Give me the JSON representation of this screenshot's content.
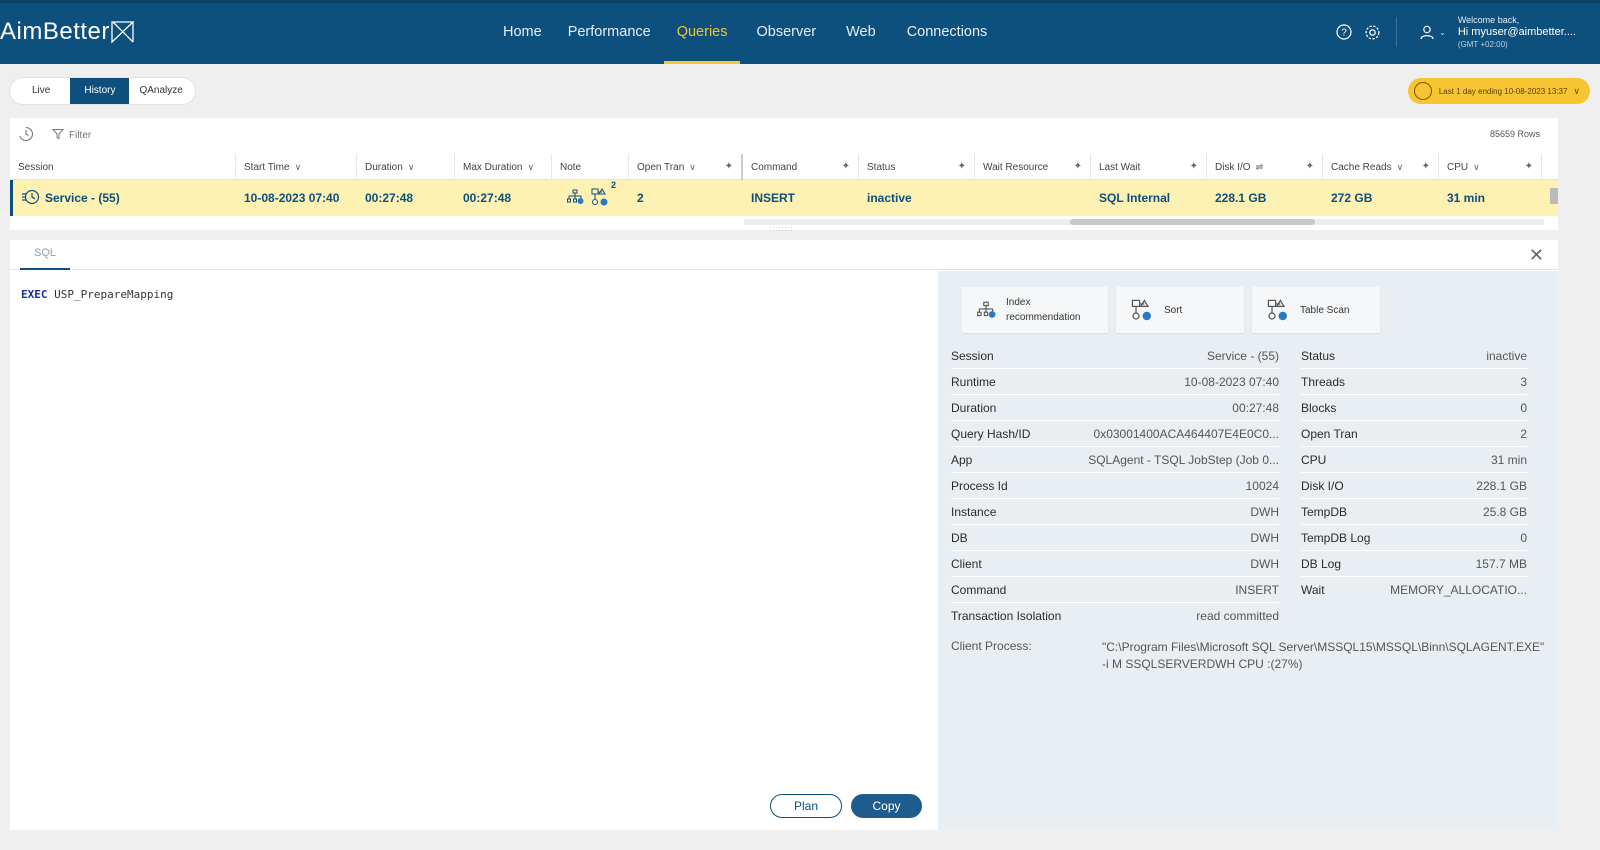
{
  "header": {
    "logo_text": "AimBetter",
    "nav": [
      {
        "label": "Home",
        "active": false
      },
      {
        "label": "Performance",
        "active": false
      },
      {
        "label": "Queries",
        "active": true
      },
      {
        "label": "Observer",
        "active": false
      },
      {
        "label": "Web",
        "active": false
      },
      {
        "label": "Connections",
        "active": false
      }
    ],
    "welcome": "Welcome back,",
    "user": "Hi myuser@aimbetter....",
    "timezone": "(GMT +02:00)",
    "icons": [
      "help-icon",
      "settings-icon",
      "user-icon"
    ]
  },
  "mode_tabs": [
    {
      "label": "Live",
      "active": false
    },
    {
      "label": "History",
      "active": true
    },
    {
      "label": "QAnalyze",
      "active": false
    }
  ],
  "time_range": "Last 1 day ending 10-08-2023 13:37",
  "toolbar": {
    "filter_label": "Filter",
    "row_count": "85659 Rows"
  },
  "table": {
    "columns": [
      "Session",
      "Start Time",
      "Duration",
      "Max Duration",
      "Note",
      "Open Tran",
      "Command",
      "Status",
      "Wait Resource",
      "Last Wait",
      "Disk I/O",
      "Cache Reads",
      "CPU"
    ],
    "row": {
      "session": "Service - (55)",
      "start_time": "10-08-2023 07:40",
      "duration": "00:27:48",
      "max_duration": "00:27:48",
      "note_badge": "2",
      "open_tran": "2",
      "command": "INSERT",
      "status": "inactive",
      "wait_resource": "",
      "last_wait": "SQL Internal",
      "disk_io": "228.1 GB",
      "cache_reads": "272 GB",
      "cpu": "31 min"
    }
  },
  "detail": {
    "tab": "SQL",
    "sql_keyword": "EXEC",
    "sql_body": " USP_PrepareMapping",
    "plan_label": "Plan",
    "copy_label": "Copy",
    "actions": {
      "index": "Index recommendation",
      "sort": "Sort",
      "scan": "Table Scan"
    },
    "left_kv": [
      {
        "k": "Session",
        "v": "Service - (55)"
      },
      {
        "k": "Runtime",
        "v": "10-08-2023 07:40"
      },
      {
        "k": "Duration",
        "v": "00:27:48"
      },
      {
        "k": "Query Hash/ID",
        "v": "0x03001400ACA464407E4E0C0..."
      },
      {
        "k": "App",
        "v": "SQLAgent - TSQL JobStep (Job 0..."
      },
      {
        "k": "Process Id",
        "v": "10024"
      },
      {
        "k": "Instance",
        "v": "DWH"
      },
      {
        "k": "DB",
        "v": "DWH"
      },
      {
        "k": "Client",
        "v": "DWH"
      },
      {
        "k": "Command",
        "v": "INSERT"
      },
      {
        "k": "Transaction Isolation",
        "v": "read committed"
      }
    ],
    "right_kv": [
      {
        "k": "Status",
        "v": "inactive"
      },
      {
        "k": "Threads",
        "v": "3"
      },
      {
        "k": "Blocks",
        "v": "0"
      },
      {
        "k": "Open Tran",
        "v": "2"
      },
      {
        "k": "CPU",
        "v": "31 min"
      },
      {
        "k": "Disk I/O",
        "v": "228.1 GB"
      },
      {
        "k": "TempDB",
        "v": "25.8 GB"
      },
      {
        "k": "TempDB Log",
        "v": "0"
      },
      {
        "k": "DB Log",
        "v": "157.7 MB"
      },
      {
        "k": "Wait",
        "v": "MEMORY_ALLOCATIO..."
      }
    ],
    "client_process_label": "Client Process:",
    "client_process_value": "\"C:\\Program Files\\Microsoft SQL Server\\MSSQL15\\MSSQL\\Binn\\SQLAGENT.EXE\" -i M SSQLSERVERDWH CPU :(27%)"
  },
  "colors": {
    "brand": "#0d4f7d",
    "accent": "#f6c531",
    "row_highlight": "#fdf1b4"
  }
}
